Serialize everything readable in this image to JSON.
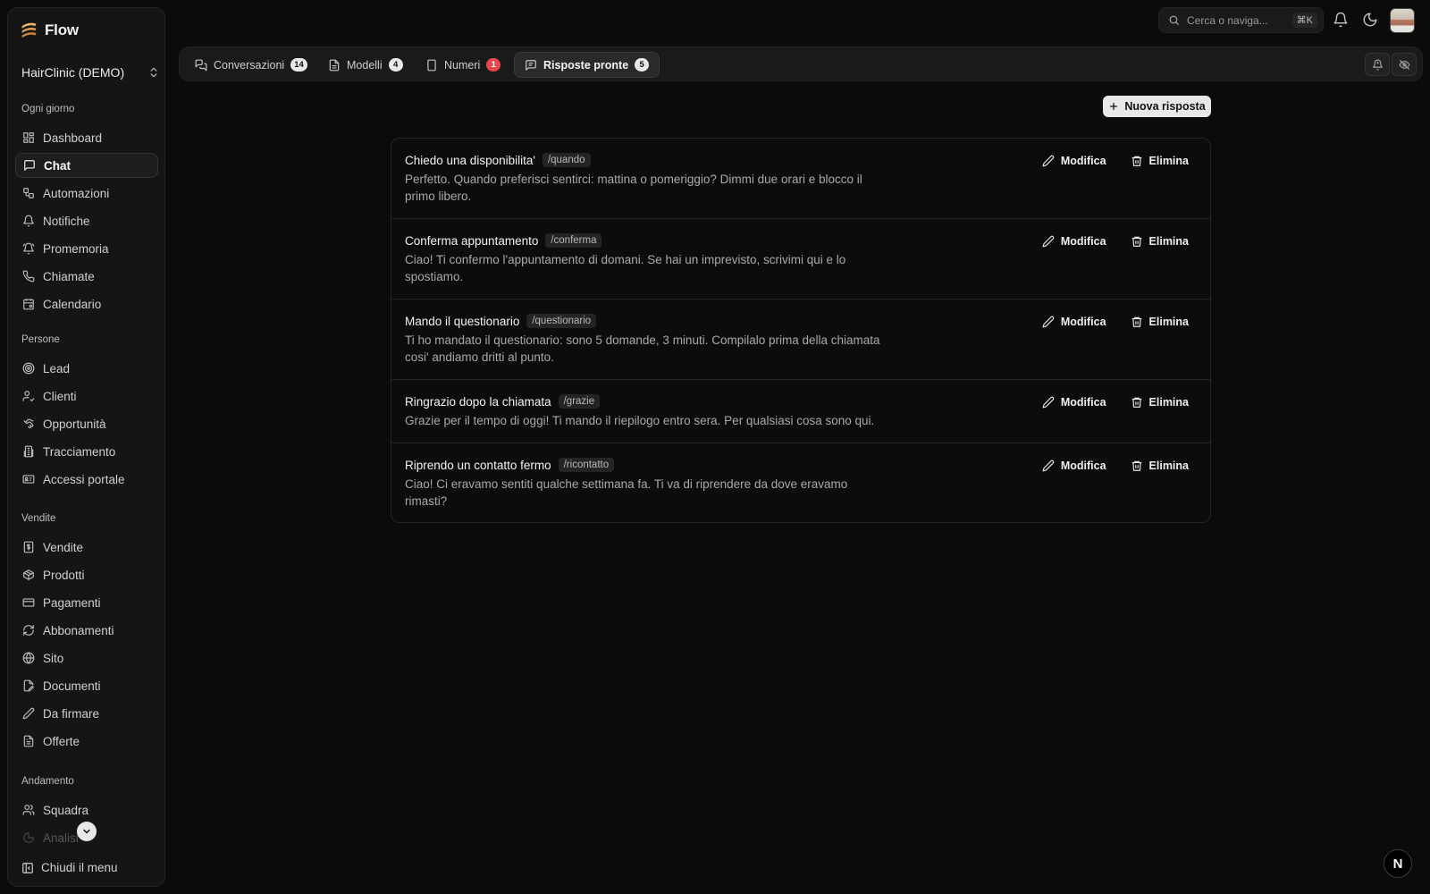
{
  "brand": {
    "name": "Flow"
  },
  "workspace": {
    "name": "HairClinic (DEMO)"
  },
  "sidebar": {
    "sections": [
      {
        "label": "Ogni giorno"
      },
      {
        "label": "Persone"
      },
      {
        "label": "Vendite"
      },
      {
        "label": "Andamento"
      }
    ],
    "items": [
      {
        "label": "Dashboard",
        "icon": "dashboard-icon"
      },
      {
        "label": "Chat",
        "icon": "chat-icon",
        "active": true
      },
      {
        "label": "Automazioni",
        "icon": "automation-icon"
      },
      {
        "label": "Notifiche",
        "icon": "bell-icon"
      },
      {
        "label": "Promemoria",
        "icon": "bell-ring-icon"
      },
      {
        "label": "Chiamate",
        "icon": "phone-icon"
      },
      {
        "label": "Calendario",
        "icon": "calendar-icon"
      },
      {
        "label": "Lead",
        "icon": "target-icon"
      },
      {
        "label": "Clienti",
        "icon": "user-check-icon"
      },
      {
        "label": "Opportunità",
        "icon": "handshake-icon"
      },
      {
        "label": "Tracciamento",
        "icon": "building-icon"
      },
      {
        "label": "Accessi portale",
        "icon": "id-card-icon"
      },
      {
        "label": "Vendite",
        "icon": "receipt-icon"
      },
      {
        "label": "Prodotti",
        "icon": "package-icon"
      },
      {
        "label": "Pagamenti",
        "icon": "credit-card-icon"
      },
      {
        "label": "Abbonamenti",
        "icon": "refresh-icon"
      },
      {
        "label": "Sito",
        "icon": "globe-icon"
      },
      {
        "label": "Documenti",
        "icon": "file-edit-icon"
      },
      {
        "label": "Da firmare",
        "icon": "pen-icon"
      },
      {
        "label": "Offerte",
        "icon": "file-text-icon"
      },
      {
        "label": "Squadra",
        "icon": "users-icon"
      },
      {
        "label": "Analisi",
        "icon": "chart-icon"
      }
    ],
    "collapse_label": "Chiudi il menu"
  },
  "search": {
    "placeholder": "Cerca o naviga...",
    "shortcut": "⌘K"
  },
  "tabs": [
    {
      "label": "Conversazioni",
      "count": "14"
    },
    {
      "label": "Modelli",
      "count": "4"
    },
    {
      "label": "Numeri",
      "count": "1"
    },
    {
      "label": "Risposte pronte",
      "count": "5",
      "active": true
    }
  ],
  "main": {
    "new_button": "Nuova risposta",
    "edit_label": "Modifica",
    "delete_label": "Elimina",
    "replies": [
      {
        "title": "Chiedo una disponibilita'",
        "shortcut": "/quando",
        "body": "Perfetto. Quando preferisci sentirci: mattina o pomeriggio? Dimmi due orari e blocco il primo libero."
      },
      {
        "title": "Conferma appuntamento",
        "shortcut": "/conferma",
        "body": "Ciao! Ti confermo l'appuntamento di domani. Se hai un imprevisto, scrivimi qui e lo spostiamo."
      },
      {
        "title": "Mando il questionario",
        "shortcut": "/questionario",
        "body": "Ti ho mandato il questionario: sono 5 domande, 3 minuti. Compilalo prima della chiamata cosi' andiamo dritti al punto."
      },
      {
        "title": "Ringrazio dopo la chiamata",
        "shortcut": "/grazie",
        "body": "Grazie per il tempo di oggi! Ti mando il riepilogo entro sera. Per qualsiasi cosa sono qui."
      },
      {
        "title": "Riprendo un contatto fermo",
        "shortcut": "/ricontatto",
        "body": "Ciao! Ci eravamo sentiti qualche settimana fa. Ti va di riprendere da dove eravamo rimasti?"
      }
    ]
  },
  "dev_badge": {
    "label": "N"
  },
  "colors": {
    "background": "#0b0b0b",
    "sidebar": "#151515",
    "accent_badge_red": "#e5484d"
  }
}
